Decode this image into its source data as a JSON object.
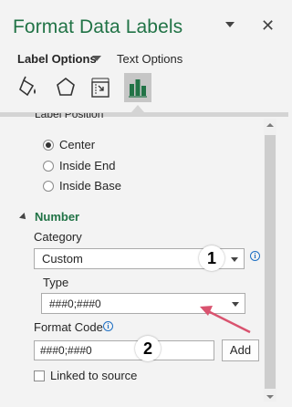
{
  "pane": {
    "title": "Format Data Labels",
    "close_glyph": "✕"
  },
  "tabs": {
    "active": "Label Options",
    "second": "Text Options"
  },
  "icons": [
    "fill-line-icon",
    "effects-pentagon-icon",
    "size-properties-icon",
    "label-options-bar-chart-icon"
  ],
  "label_position": {
    "heading_partial": "Label Position",
    "options": [
      {
        "label": "Center",
        "checked": true
      },
      {
        "label": "Inside End",
        "checked": false
      },
      {
        "label": "Inside Base",
        "checked": false
      }
    ]
  },
  "number": {
    "section_title": "Number",
    "category_label": "Category",
    "category_value": "Custom",
    "type_label": "Type",
    "type_value": "###0;###0",
    "format_code_label": "Format Code",
    "format_code_value": "###0;###0",
    "add_button": "Add",
    "linked_to_source": "Linked to source"
  },
  "annotations": {
    "badge_1": "1",
    "badge_2": "2",
    "arrow_color": "#d9536f"
  },
  "colors": {
    "accent": "#217346",
    "background": "#f3f3f3",
    "info": "#1e6fc3"
  }
}
